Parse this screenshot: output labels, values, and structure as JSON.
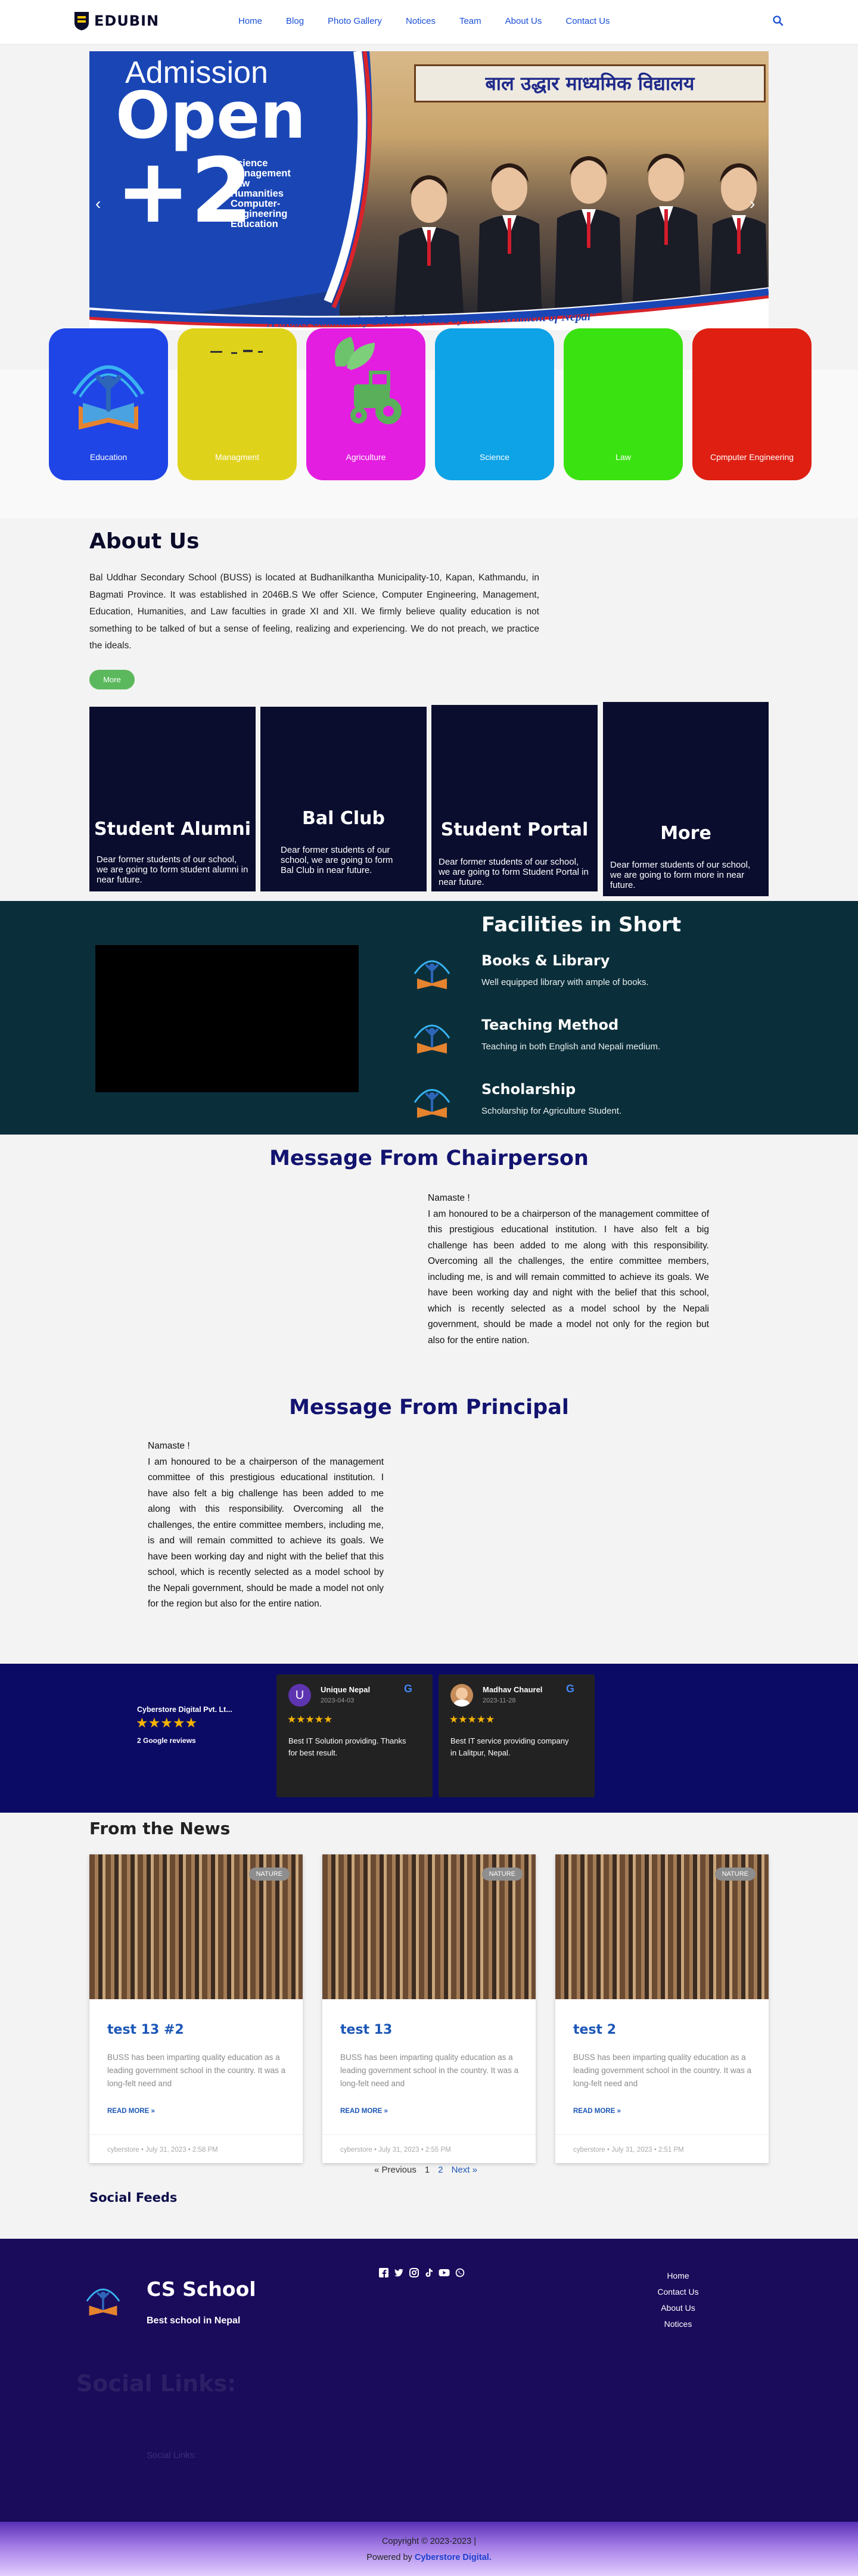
{
  "header": {
    "brand": "EDUBIN",
    "nav": [
      "Home",
      "Blog",
      "Photo Gallery",
      "Notices",
      "Team",
      "About Us",
      "Contact Us"
    ],
    "search_icon": "search-icon"
  },
  "hero": {
    "line1": "Admission",
    "line2": "Open",
    "plus2": "+2",
    "streams": [
      "Science",
      "Management",
      "Law",
      "Humanities",
      "Computer-",
      "Engineering",
      "Education"
    ],
    "school_sign": "बाल उद्धार माध्यमिक विद्यालय",
    "banner_caption": "\"A Model Community School Selected by the Government of Nepal\"",
    "prev_icon": "chevron-left-icon",
    "next_icon": "chevron-right-icon"
  },
  "categories": [
    {
      "label": "Education",
      "color": "#1f45e6"
    },
    {
      "label": "Managment",
      "color": "#dfd21b"
    },
    {
      "label": "Agriculture",
      "color": "#e31ee0"
    },
    {
      "label": "Science",
      "color": "#0ea2e6"
    },
    {
      "label": "Law",
      "color": "#3be211"
    },
    {
      "label": "Cpmputer Engineering",
      "color": "#de1f12"
    }
  ],
  "about": {
    "title": "About Us",
    "text": "Bal Uddhar Secondary School (BUSS) is located at Budhanilkantha Municipality-10, Kapan, Kathmandu, in Bagmati Province. It was established in 2046B.S We offer Science, Computer Engineering, Management, Education, Humanities, and Law faculties in grade XI and XII. We firmly believe quality education is not something to be talked of but a sense of feeling, realizing and experiencing. We do not preach, we practice the ideals.",
    "more_button": "More"
  },
  "cards": [
    {
      "title": "Student Alumni",
      "desc": "Dear former students of our school, we are going to form student alumni in near future."
    },
    {
      "title": "Bal Club",
      "desc": "Dear former students of our school, we are going to form Bal Club in near future."
    },
    {
      "title": "Student Portal",
      "desc": "Dear former students of our school, we are going to form Student Portal in near future."
    },
    {
      "title": "More",
      "desc": "Dear former students of our school, we are going to form more in near future."
    }
  ],
  "facilities": {
    "title": "Facilities in Short",
    "items": [
      {
        "title": "Books & Library",
        "desc": "Well equipped library with ample of books."
      },
      {
        "title": "Teaching Method",
        "desc": "Teaching in both English and Nepali medium."
      },
      {
        "title": "Scholarship",
        "desc": "Scholarship for Agriculture Student."
      }
    ]
  },
  "chairperson": {
    "title": "Message From Chairperson",
    "greeting": "Namaste !",
    "text": "I am honoured to be a chairperson of the management committee of this prestigious educational institution. I have also felt a big challenge has been added to me along with this responsibility. Overcoming all the challenges, the entire committee members, including me, is and will remain committed to achieve its goals. We have been working day and night with the belief that this school, which is recently selected as a model school by the Nepali government, should be made a model not only for the region but also for the entire nation."
  },
  "principal": {
    "title": "Message From Principal",
    "greeting": "Namaste !",
    "text": "I am honoured to be a chairperson of the management committee of this prestigious educational institution. I have also felt a big challenge has been added to me along with this responsibility. Overcoming all the challenges, the entire committee members, including me, is and will remain committed to achieve its goals. We have been working day and night with the belief that this school, which is recently selected as a model school by the Nepali government, should be made a model not only for the region but also for the entire nation."
  },
  "reviews": {
    "business": "Cyberstore Digital Pvt. Lt...",
    "stars": "★★★★★",
    "count": "2 Google reviews",
    "items": [
      {
        "initial": "U",
        "name": "Unique Nepal",
        "date": "2023-04-03",
        "stars": "★★★★★",
        "text": "Best IT Solution providing. Thanks for best result."
      },
      {
        "initial": "M",
        "name": "Madhav Chaurel",
        "date": "2023-11-28",
        "stars": "★★★★★",
        "text": "Best IT service providing company in Lalitpur, Nepal."
      }
    ]
  },
  "news": {
    "title": "From the News",
    "items": [
      {
        "title": "test 13 #2",
        "badge": "NATURE",
        "excerpt": "BUSS has been imparting quality education as a leading government school in the country. It was a long-felt need and",
        "read_more": "READ MORE »",
        "meta": "cyberstore  •  July 31, 2023  •  2:58 PM"
      },
      {
        "title": "test 13",
        "badge": "NATURE",
        "excerpt": "BUSS has been imparting quality education as a leading government school in the country. It was a long-felt need and",
        "read_more": "READ MORE »",
        "meta": "cyberstore  •  July 31, 2023  •  2:55 PM"
      },
      {
        "title": "test 2",
        "badge": "NATURE",
        "excerpt": "BUSS has been imparting quality education as a leading government school in the country. It was a long-felt need and",
        "read_more": "READ MORE »",
        "meta": "cyberstore  •  July 31, 2023  •  2:51 PM"
      }
    ],
    "pagination": {
      "prev": "« Previous",
      "p1": "1",
      "p2": "2",
      "next": "Next »"
    }
  },
  "social_feeds": {
    "title": "Social Feeds"
  },
  "footer": {
    "school": "CS School",
    "tagline": "Best school in Nepal",
    "social_icons": [
      "facebook-icon",
      "twitter-icon",
      "instagram-icon",
      "tiktok-icon",
      "youtube-icon",
      "whatsapp-icon"
    ],
    "links": [
      "Home",
      "Contact Us",
      "About Us",
      "Notices"
    ],
    "social_links_heading": "Social Links:",
    "social_links_small": "Social Links:",
    "copyright": "Copyright © 2023-2023 |",
    "powered_prefix": "Powered by",
    "powered_by": "Cyberstore Digital."
  }
}
